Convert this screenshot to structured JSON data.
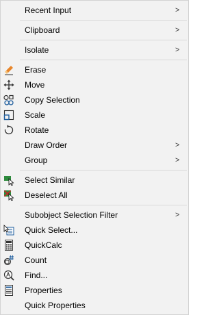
{
  "menu": {
    "items": {
      "recent_input": {
        "label": "Recent Input",
        "submenu": ">"
      },
      "clipboard": {
        "label": "Clipboard",
        "submenu": ">"
      },
      "isolate": {
        "label": "Isolate",
        "submenu": ">"
      },
      "erase": {
        "label": "Erase",
        "icon": "eraser-icon"
      },
      "move": {
        "label": "Move",
        "icon": "move-arrows-icon"
      },
      "copy_selection": {
        "label": "Copy Selection",
        "icon": "copy-objects-icon"
      },
      "scale": {
        "label": "Scale",
        "icon": "scale-icon"
      },
      "rotate": {
        "label": "Rotate",
        "icon": "rotate-icon"
      },
      "draw_order": {
        "label": "Draw Order",
        "submenu": ">"
      },
      "group": {
        "label": "Group",
        "submenu": ">"
      },
      "select_similar": {
        "label": "Select Similar",
        "icon": "select-similar-icon"
      },
      "deselect_all": {
        "label": "Deselect All",
        "icon": "deselect-all-icon"
      },
      "subobject_selection_filter": {
        "label": "Subobject Selection Filter",
        "submenu": ">"
      },
      "quick_select": {
        "label": "Quick Select...",
        "icon": "quick-select-icon"
      },
      "quickcalc": {
        "label": "QuickCalc",
        "icon": "calculator-icon"
      },
      "count": {
        "label": "Count",
        "icon": "count-icon"
      },
      "find": {
        "label": "Find...",
        "icon": "find-text-icon"
      },
      "properties": {
        "label": "Properties",
        "icon": "properties-icon"
      },
      "quick_properties": {
        "label": "Quick Properties"
      }
    }
  },
  "colors": {
    "background": "#f2f2f2",
    "separator": "#d9d9d9",
    "icon_blue": "#1f5e9e",
    "icon_dark": "#333333",
    "icon_green": "#2e8b3d",
    "icon_red": "#c62828",
    "icon_orange": "#e8862a"
  }
}
